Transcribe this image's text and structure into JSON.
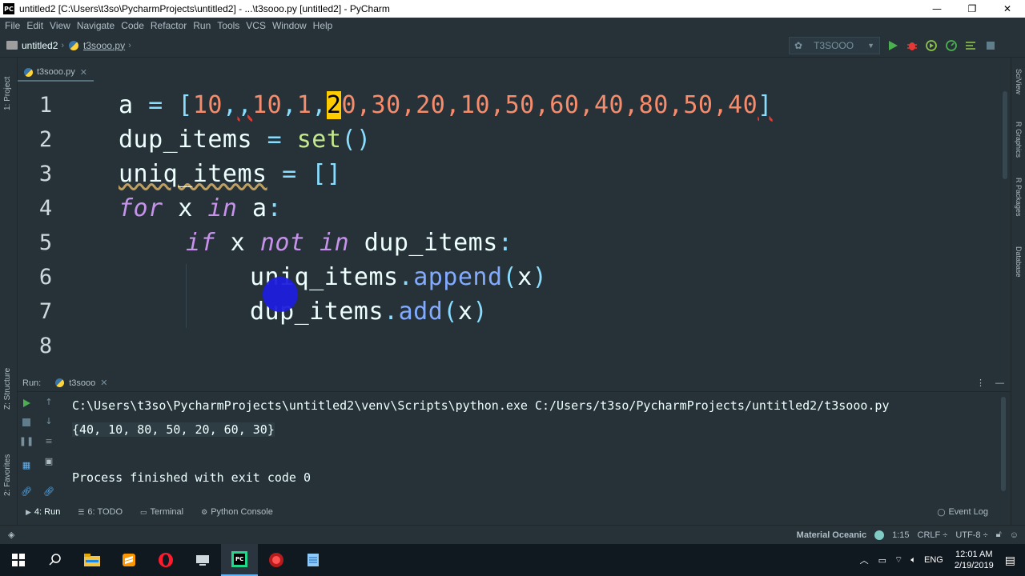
{
  "window": {
    "title": "untitled2 [C:\\Users\\t3so\\PycharmProjects\\untitled2] - ...\\t3sooo.py [untitled2] - PyCharm",
    "logo_text": "PC",
    "minimize": "—",
    "restore": "❐",
    "close": "✕"
  },
  "menu": [
    "File",
    "Edit",
    "View",
    "Navigate",
    "Code",
    "Refactor",
    "Run",
    "Tools",
    "VCS",
    "Window",
    "Help"
  ],
  "breadcrumb": {
    "project": "untitled2",
    "file": "t3sooo.py"
  },
  "run_config": {
    "name": "T3SOOO"
  },
  "left_stripe": {
    "project": "1: Project",
    "structure": "Z: Structure",
    "favorites": "2: Favorites"
  },
  "right_stripe": {
    "sciview": "SciView",
    "r_graphics": "R Graphics",
    "r_packages": "R Packages",
    "database": "Database"
  },
  "editor_tab": {
    "label": "t3sooo.py"
  },
  "editor": {
    "line_numbers": [
      "1",
      "2",
      "3",
      "4",
      "5",
      "6",
      "7",
      "8"
    ],
    "line1": {
      "var": "a",
      "eq": " = ",
      "open": "[",
      "n1": "10",
      "sep1": ",",
      "sep1b": ",",
      "n2": "10",
      "sep2": ",",
      "n3": "1",
      "sep3": ",",
      "n4a": "2",
      "n4b": "0",
      "rest": ",30,20,10,50,60,40,80,50,40",
      "close": "]"
    },
    "line2": {
      "name": "dup_items",
      "eq": " = ",
      "fn": "set",
      "parens": "()"
    },
    "line3": {
      "name": "uniq_items",
      "eq": " = ",
      "brackets": "[]"
    },
    "line4": {
      "kw_for": "for",
      "var": " x ",
      "kw_in": "in",
      "iter": " a",
      "colon": ":"
    },
    "line5": {
      "kw_if": "if",
      "var": " x ",
      "kw_not": "not",
      "kw_in": " in",
      "target": " dup_items",
      "colon": ":"
    },
    "line6": {
      "obj": "uniq_items",
      "dot": ".",
      "method": "append",
      "open": "(",
      "arg": "x",
      "close": ")"
    },
    "line7": {
      "obj": "dup_items",
      "dot": ".",
      "method": "add",
      "open": "(",
      "arg": "x",
      "close": ")"
    }
  },
  "run_panel": {
    "label": "Run:",
    "tab": "t3sooo",
    "lines": [
      "C:\\Users\\t3so\\PycharmProjects\\untitled2\\venv\\Scripts\\python.exe C:/Users/t3so/PycharmProjects/untitled2/t3sooo.py",
      "{40, 10, 80, 50, 20, 60, 30}",
      "Process finished with exit code 0"
    ]
  },
  "tool_tabs": {
    "run": "4: Run",
    "todo": "6: TODO",
    "terminal": "Terminal",
    "python_console": "Python Console",
    "event_log": "Event Log"
  },
  "status": {
    "theme": "Material Oceanic",
    "position": "1:15",
    "line_sep": "CRLF ÷",
    "encoding": "UTF-8 ÷"
  },
  "taskbar": {
    "lang": "ENG",
    "time": "12:01 AM",
    "date": "2/19/2019"
  }
}
